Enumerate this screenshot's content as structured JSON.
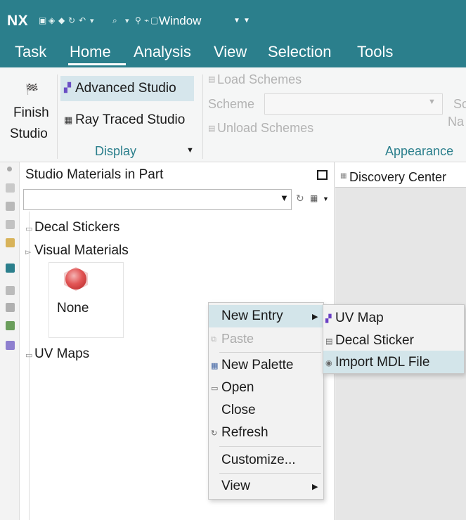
{
  "app": {
    "logo": "NX",
    "window_menu": "Window"
  },
  "menubar": {
    "tabs": [
      "Task",
      "Home",
      "Analysis",
      "View",
      "Selection",
      "Tools"
    ],
    "active_tab": "Home"
  },
  "ribbon": {
    "finish_studio": [
      "Finish",
      "Studio"
    ],
    "advanced_studio": "Advanced Studio",
    "ray_traced_studio": "Ray Traced Studio",
    "display_group": "Display",
    "load_schemes": "Load Schemes",
    "scheme_label": "Scheme",
    "unload_schemes": "Unload Schemes",
    "sc_cut": "Sc",
    "na_cut": "Na",
    "appearance_group": "Appearance"
  },
  "panel": {
    "title": "Studio Materials in Part",
    "filter_value": "",
    "tree": {
      "decal_stickers": "Decal Stickers",
      "visual_materials": "Visual Materials",
      "material_tile": "None",
      "uv_maps": "UV Maps"
    }
  },
  "view_tab": {
    "label": "Discovery Center"
  },
  "context_menu": {
    "new_entry": "New Entry",
    "paste": "Paste",
    "new_palette": "New Palette",
    "open": "Open",
    "close": "Close",
    "refresh": "Refresh",
    "customize": "Customize...",
    "view": "View"
  },
  "submenu": {
    "uv_map": "UV Map",
    "decal_sticker": "Decal Sticker",
    "import_mdl_file": "Import MDL File"
  },
  "colors": {
    "title_bar": "#2b7f8c",
    "hover": "#d3e5ea",
    "accent_text": "#2b7f8c"
  }
}
